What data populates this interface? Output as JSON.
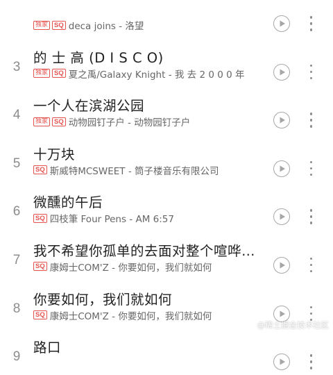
{
  "songs": [
    {
      "num": "",
      "title": "",
      "badges": [
        "独家",
        "SQ"
      ],
      "subtitle": "deca joins - 洛望"
    },
    {
      "num": "3",
      "title": "的 士 高 (D I S C O)",
      "badges": [
        "独家",
        "SQ"
      ],
      "subtitle": "夏之禹/Galaxy Knight - 我 去 2 0 0 0 年"
    },
    {
      "num": "4",
      "title": "一个人在滨湖公园",
      "badges": [
        "独家",
        "SQ"
      ],
      "subtitle": "动物园钉子户 - 动物园钉子户"
    },
    {
      "num": "5",
      "title": "十万块",
      "badges": [
        "SQ"
      ],
      "subtitle": "斯威特MCSWEET - 筒子楼音乐有限公司"
    },
    {
      "num": "6",
      "title": "微醺的午后",
      "badges": [
        "SQ"
      ],
      "subtitle": "四枝筆 Four Pens - AM 6:57"
    },
    {
      "num": "7",
      "title": "我不希望你孤单的去面对整个喧哗…",
      "badges": [
        "SQ"
      ],
      "subtitle": "康姆士COM'Z - 你要如何，我们就如何"
    },
    {
      "num": "8",
      "title": "你要如何，我们就如何",
      "badges": [
        "SQ"
      ],
      "subtitle": "康姆士COM'Z - 你要如何，我们就如何"
    },
    {
      "num": "9",
      "title": "路口",
      "badges": [],
      "subtitle": ""
    }
  ],
  "watermark": "@稀土掘金技术社区",
  "colors": {
    "badge": "#e6534f",
    "icon": "#a6a6a6",
    "number": "#8c8c8c"
  },
  "icons": {
    "play": "play-circle-icon",
    "more": "more-vertical-icon"
  }
}
